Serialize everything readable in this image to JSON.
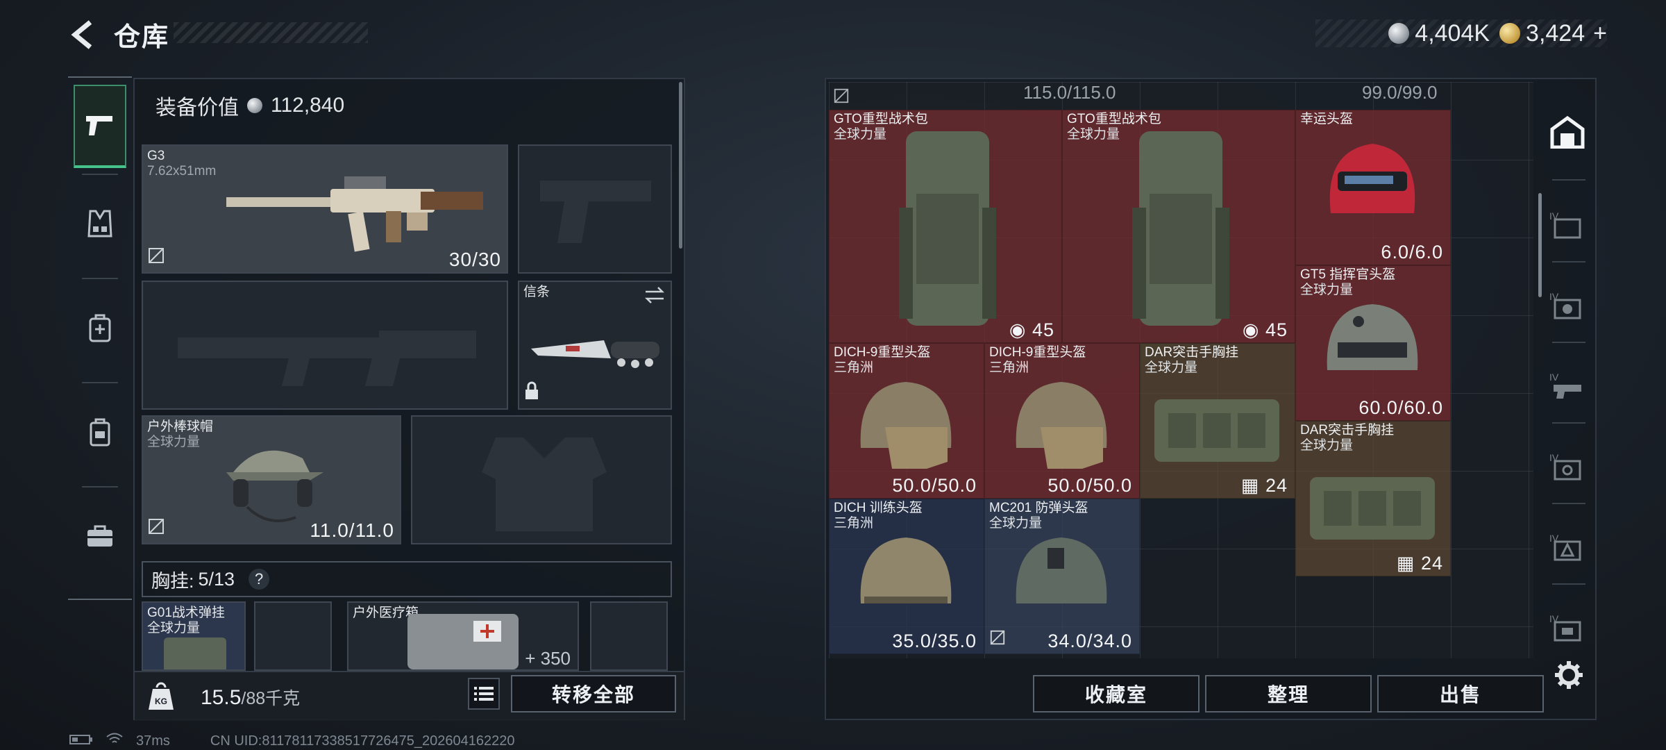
{
  "header": {
    "title": "仓库"
  },
  "currency": {
    "silver": "4,404K",
    "gold": "3,424",
    "add_label": "+"
  },
  "equipment": {
    "value_label": "装备价值",
    "value": "112,840",
    "slots": {
      "primary": {
        "name": "G3",
        "caliber": "7.62x51mm",
        "ammo": "30/30"
      },
      "melee": {
        "name": "信条"
      },
      "helmet": {
        "name": "户外棒球帽",
        "sub": "全球力量",
        "durability": "11.0/11.0"
      }
    },
    "chest_rig": {
      "label": "胸挂:",
      "count": "5/13",
      "help": "?"
    },
    "rig_items": [
      {
        "name": "G01战术弹挂",
        "sub": "全球力量"
      },
      {
        "name": "户外医疗箱",
        "value": "350"
      }
    ],
    "weight": {
      "current": "15.5",
      "max": "/88千克"
    },
    "transfer_all_label": "转移全部"
  },
  "warehouse": {
    "capacity_left": "115.0/115.0",
    "capacity_right": "99.0/99.0",
    "items": [
      {
        "name": "GTO重型战术包",
        "sub": "全球力量",
        "value": "45",
        "icon": "backpack-capacity-icon"
      },
      {
        "name": "GTO重型战术包",
        "sub": "全球力量",
        "value": "45",
        "icon": "backpack-capacity-icon"
      },
      {
        "name": "幸运头盔",
        "sub": "",
        "value": "6.0/6.0"
      },
      {
        "name": "GT5 指挥官头盔",
        "sub": "全球力量",
        "value": "60.0/60.0"
      },
      {
        "name": "DICH-9重型头盔",
        "sub": "三角洲",
        "value": "50.0/50.0"
      },
      {
        "name": "DICH-9重型头盔",
        "sub": "三角洲",
        "value": "50.0/50.0"
      },
      {
        "name": "DAR突击手胸挂",
        "sub": "全球力量",
        "value": "24",
        "icon": "rig-capacity-icon"
      },
      {
        "name": "DAR突击手胸挂",
        "sub": "全球力量",
        "value": "24",
        "icon": "rig-capacity-icon"
      },
      {
        "name": "DICH 训练头盔",
        "sub": "三角洲",
        "value": "35.0/35.0"
      },
      {
        "name": "MC201 防弹头盔",
        "sub": "全球力量",
        "value": "34.0/34.0"
      }
    ],
    "buttons": {
      "collection": "收藏室",
      "sort": "整理",
      "sell": "出售"
    }
  },
  "status": {
    "ping": "37ms",
    "uid": "CN UID:8117811733851772647​5_202604162220"
  },
  "colors": {
    "accent": "#46c28d",
    "rarity_red": "#782c30",
    "rarity_blue": "#34425c",
    "rarity_brown": "#5c4832"
  }
}
